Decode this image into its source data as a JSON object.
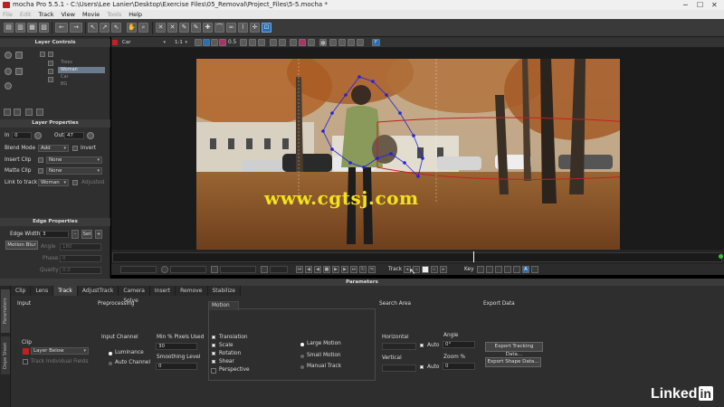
{
  "window": {
    "title": "mocha Pro 5.5.1 - C:\\Users\\Lee Lanier\\Desktop\\Exercise Files\\05_Removal\\Project_Files\\5-5.mocha *"
  },
  "menu": [
    "File",
    "Edit",
    "Track",
    "View",
    "Movie",
    "Tools",
    "Help"
  ],
  "menu_disabled": [
    "File",
    "Edit",
    "Tools"
  ],
  "viewer_bar": {
    "layer_select": "Car",
    "zoom": "1:1",
    "value": "0.5",
    "flag": "F"
  },
  "layer_controls": {
    "title": "Layer Controls",
    "layers": [
      {
        "name": "Trees",
        "selected": false
      },
      {
        "name": "Woman",
        "selected": true
      },
      {
        "name": "Car",
        "selected": false
      },
      {
        "name": "BG",
        "selected": false
      }
    ]
  },
  "layer_properties": {
    "title": "Layer Properties",
    "in_label": "In",
    "in_value": "0",
    "out_label": "Out",
    "out_value": "47",
    "blend_mode_label": "Blend Mode",
    "blend_mode_value": "Add",
    "invert_label": "Invert",
    "insert_clip_label": "Insert Clip",
    "insert_clip_value": "None",
    "matte_clip_label": "Matte Clip",
    "matte_clip_value": "None",
    "link_label": "Link to track",
    "link_value": "Woman",
    "adjusted_label": "Adjusted"
  },
  "edge_properties": {
    "title": "Edge Properties",
    "edge_width_label": "Edge Width",
    "edge_width_value": "3",
    "set_label": "Set",
    "motion_blur_label": "Motion Blur",
    "angle_label": "Angle",
    "angle_value": "180",
    "phase_label": "Phase",
    "phase_value": "0",
    "quality_label": "Quality",
    "quality_value": "0.0"
  },
  "transport": {
    "track_label": "Track",
    "key_label": "Key"
  },
  "watermark": "www.cgtsj.com",
  "parameters": {
    "title": "Parameters",
    "side_tabs": [
      "Parameters",
      "Dope Sheet"
    ],
    "tabs": [
      "Clip",
      "Lens",
      "Track",
      "AdjustTrack",
      "Camera Solve",
      "Insert",
      "Remove",
      "Stabilize"
    ],
    "active_tab": "Track",
    "input": {
      "heading": "Input",
      "clip_label": "Clip",
      "clip_value": "Layer Below",
      "track_individual": "Track Individual Fields"
    },
    "preprocessing": {
      "heading": "Preprocessing",
      "input_channel": "Input Channel",
      "luminance": "Luminance",
      "auto_channel": "Auto Channel",
      "min_pixels_label": "Min % Pixels Used",
      "min_pixels_value": "30",
      "smoothing_label": "Smoothing Level",
      "smoothing_value": "0"
    },
    "motion": {
      "heading": "Motion",
      "checks": [
        "Translation",
        "Scale",
        "Rotation",
        "Shear",
        "Perspective"
      ],
      "checked": [
        true,
        true,
        true,
        true,
        false
      ],
      "radios": [
        "Large Motion",
        "Small Motion",
        "Manual Track"
      ],
      "radio_selected": "Large Motion"
    },
    "search_area": {
      "heading": "Search Area",
      "horizontal_label": "Horizontal",
      "vertical_label": "Vertical",
      "auto_label": "Auto",
      "angle_label": "Angle",
      "angle_value": "0°",
      "zoom_label": "Zoom %",
      "zoom_value": "0"
    },
    "export_data": {
      "heading": "Export Data",
      "tracking_button": "Export Tracking Data...",
      "shape_button": "Export Shape Data..."
    }
  },
  "logo": {
    "text": "Linked",
    "suffix": "in"
  },
  "colors": {
    "accent": "#2a6fb6",
    "spline": "#2222dd",
    "watermark": "#f2e21e",
    "tracker_red": "#c42020"
  }
}
